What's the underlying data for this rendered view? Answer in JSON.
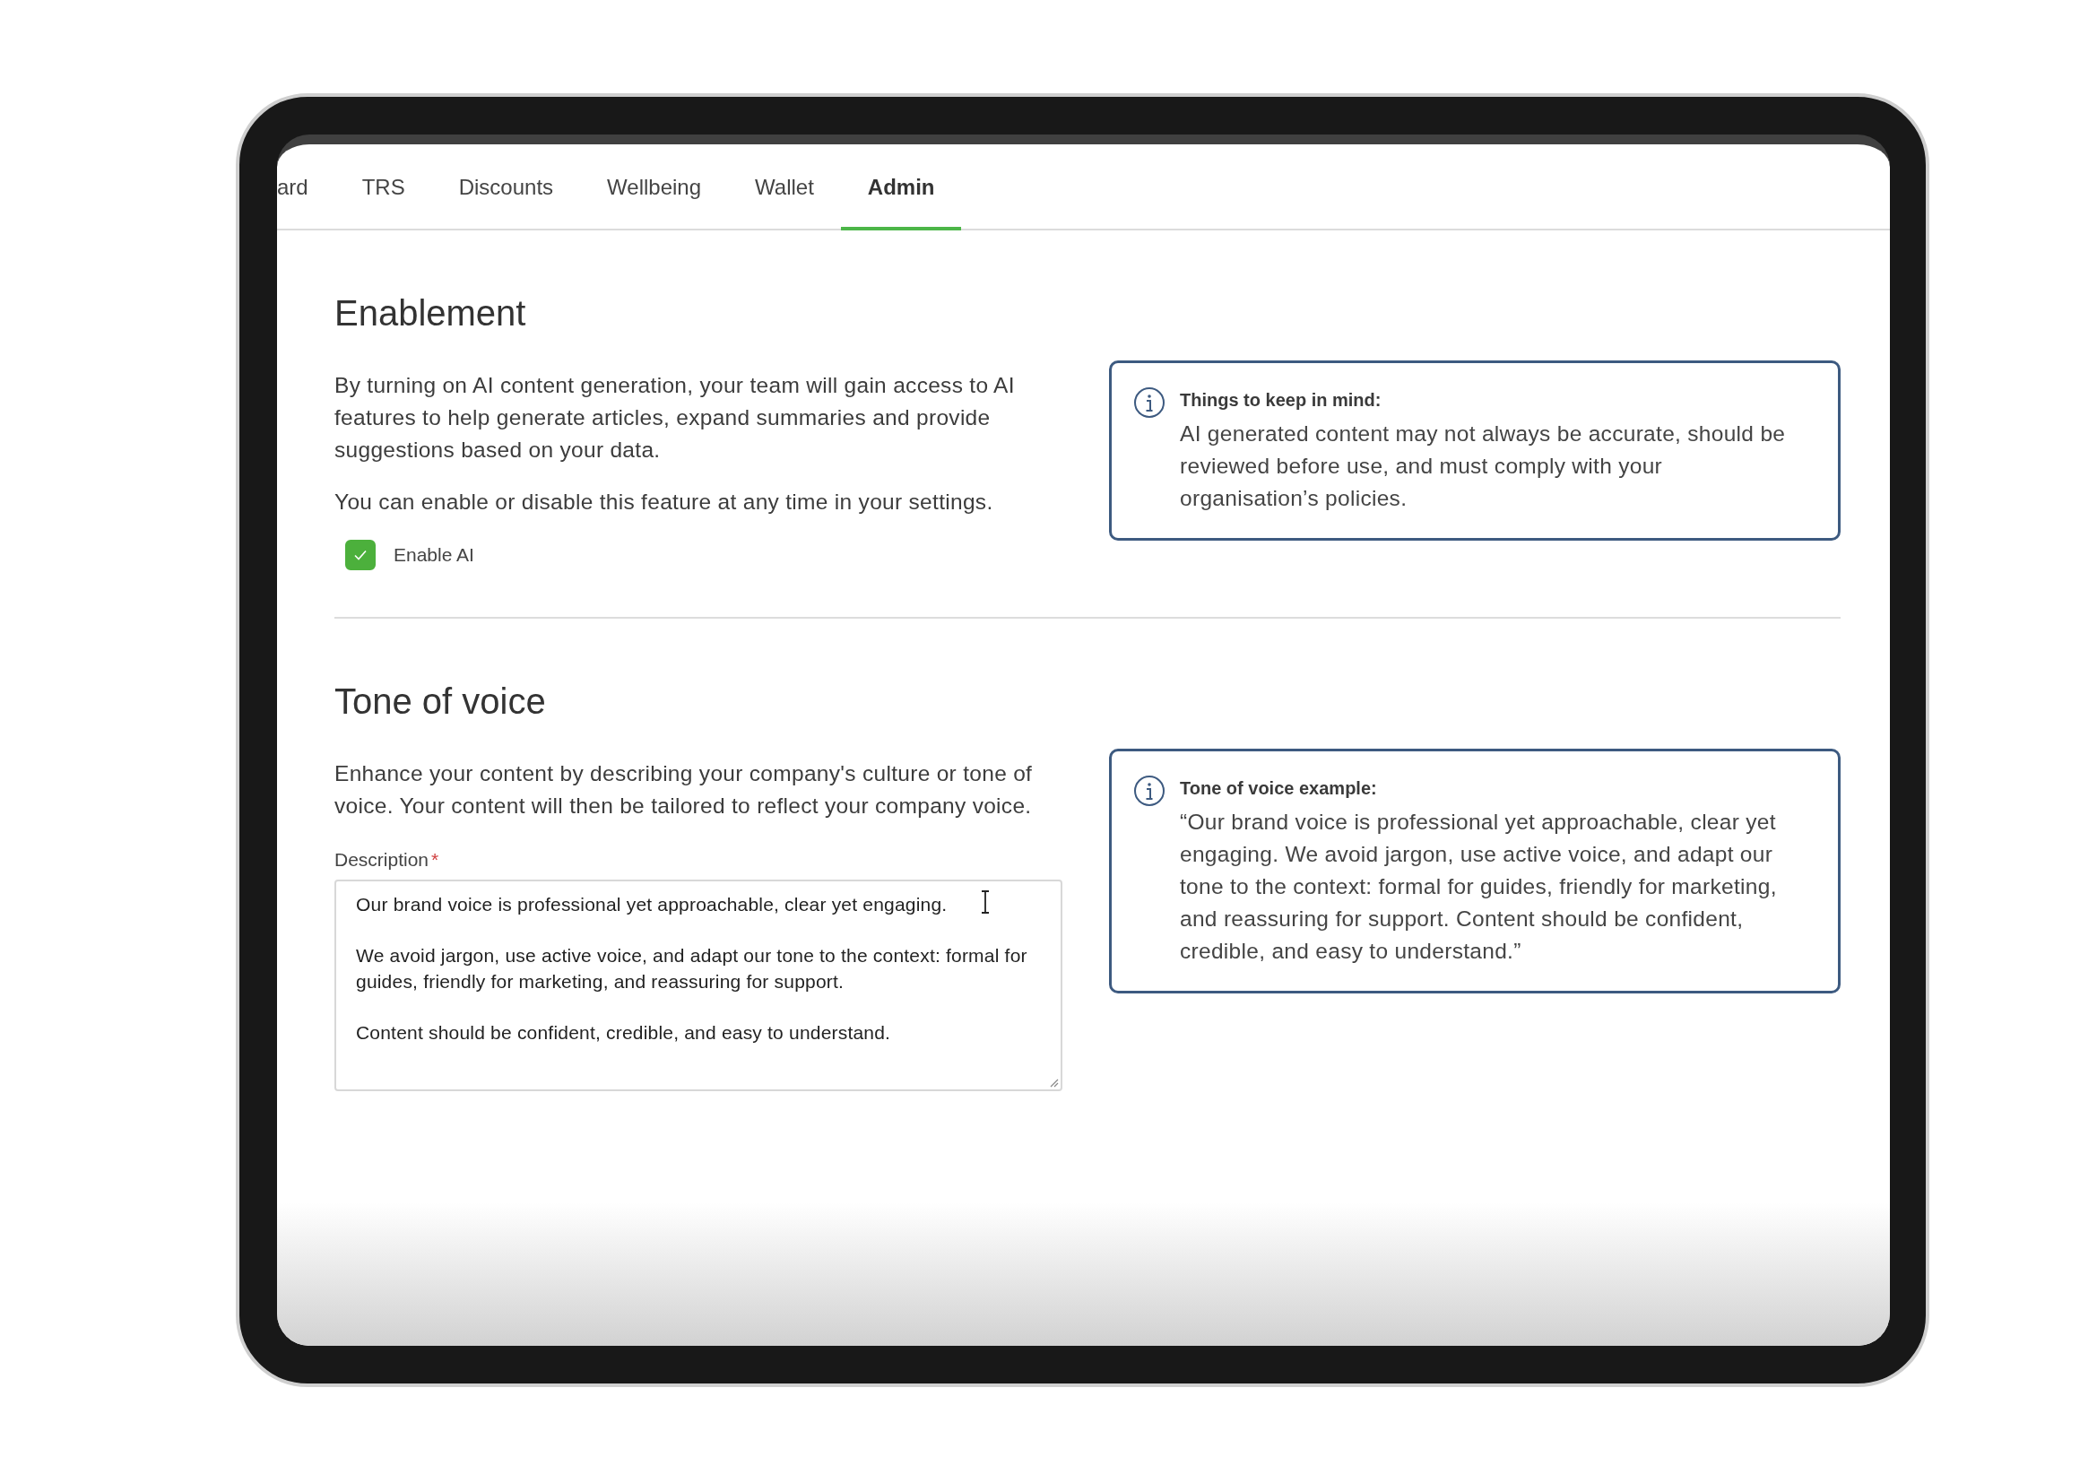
{
  "tabs": [
    {
      "label": "ard",
      "selected": false
    },
    {
      "label": "TRS",
      "selected": false
    },
    {
      "label": "Discounts",
      "selected": false
    },
    {
      "label": "Wellbeing",
      "selected": false
    },
    {
      "label": "Wallet",
      "selected": false
    },
    {
      "label": "Admin",
      "selected": true
    }
  ],
  "sections": [
    {
      "heading": "Enablement",
      "paragraphs": [
        "By turning on AI content generation, your team will gain access to AI features to help generate articles, expand summaries and provide suggestions based on your data.",
        "You can enable or disable this feature at any time in your settings."
      ],
      "checkbox": {
        "label": "Enable AI",
        "checked": true
      },
      "info": {
        "title": "Things to keep in mind:",
        "text": "AI generated content may not always be accurate, should be reviewed before use, and must comply with your organisation’s policies."
      }
    },
    {
      "heading": "Tone of voice",
      "paragraphs": [
        "Enhance your content by describing your company's culture or tone of voice. Your content will then be tailored to reflect your company voice."
      ],
      "field": {
        "label": "Description",
        "required_mark": "*",
        "value": "Our brand voice is professional yet approachable, clear yet engaging.\n\nWe avoid jargon, use active voice, and adapt our tone to the context: formal for guides, friendly for marketing, and reassuring for support.\n\nContent should be confident, credible, and easy to understand."
      },
      "info": {
        "title": "Tone of voice example:",
        "text": "“Our brand voice is professional yet approachable, clear yet engaging. We avoid jargon, use active voice, and adapt our tone to the context: formal for guides, friendly for marketing, and reassuring for support. Content should be confident, credible, and easy to understand.”"
      }
    }
  ]
}
